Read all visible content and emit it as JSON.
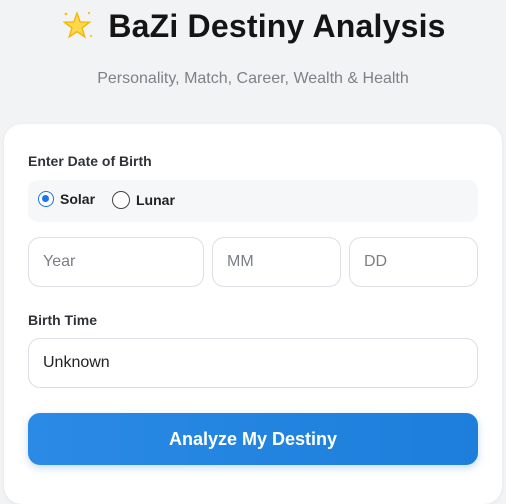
{
  "header": {
    "title": "BaZi Destiny Analysis",
    "subtitle": "Personality, Match, Career, Wealth & Health",
    "title_icon": "glowing-star-icon"
  },
  "form": {
    "date_label": "Enter Date of Birth",
    "calendar_options": [
      {
        "label": "Solar",
        "checked": true
      },
      {
        "label": "Lunar",
        "checked": false
      }
    ],
    "year_placeholder": "Year",
    "month_placeholder": "MM",
    "day_placeholder": "DD",
    "time_label": "Birth Time",
    "time_value": "Unknown",
    "submit_label": "Analyze My Destiny"
  },
  "colors": {
    "accent": "#1a73e8",
    "button": "#2385e0",
    "background": "#f2f3f5",
    "star": "#f5c518"
  }
}
